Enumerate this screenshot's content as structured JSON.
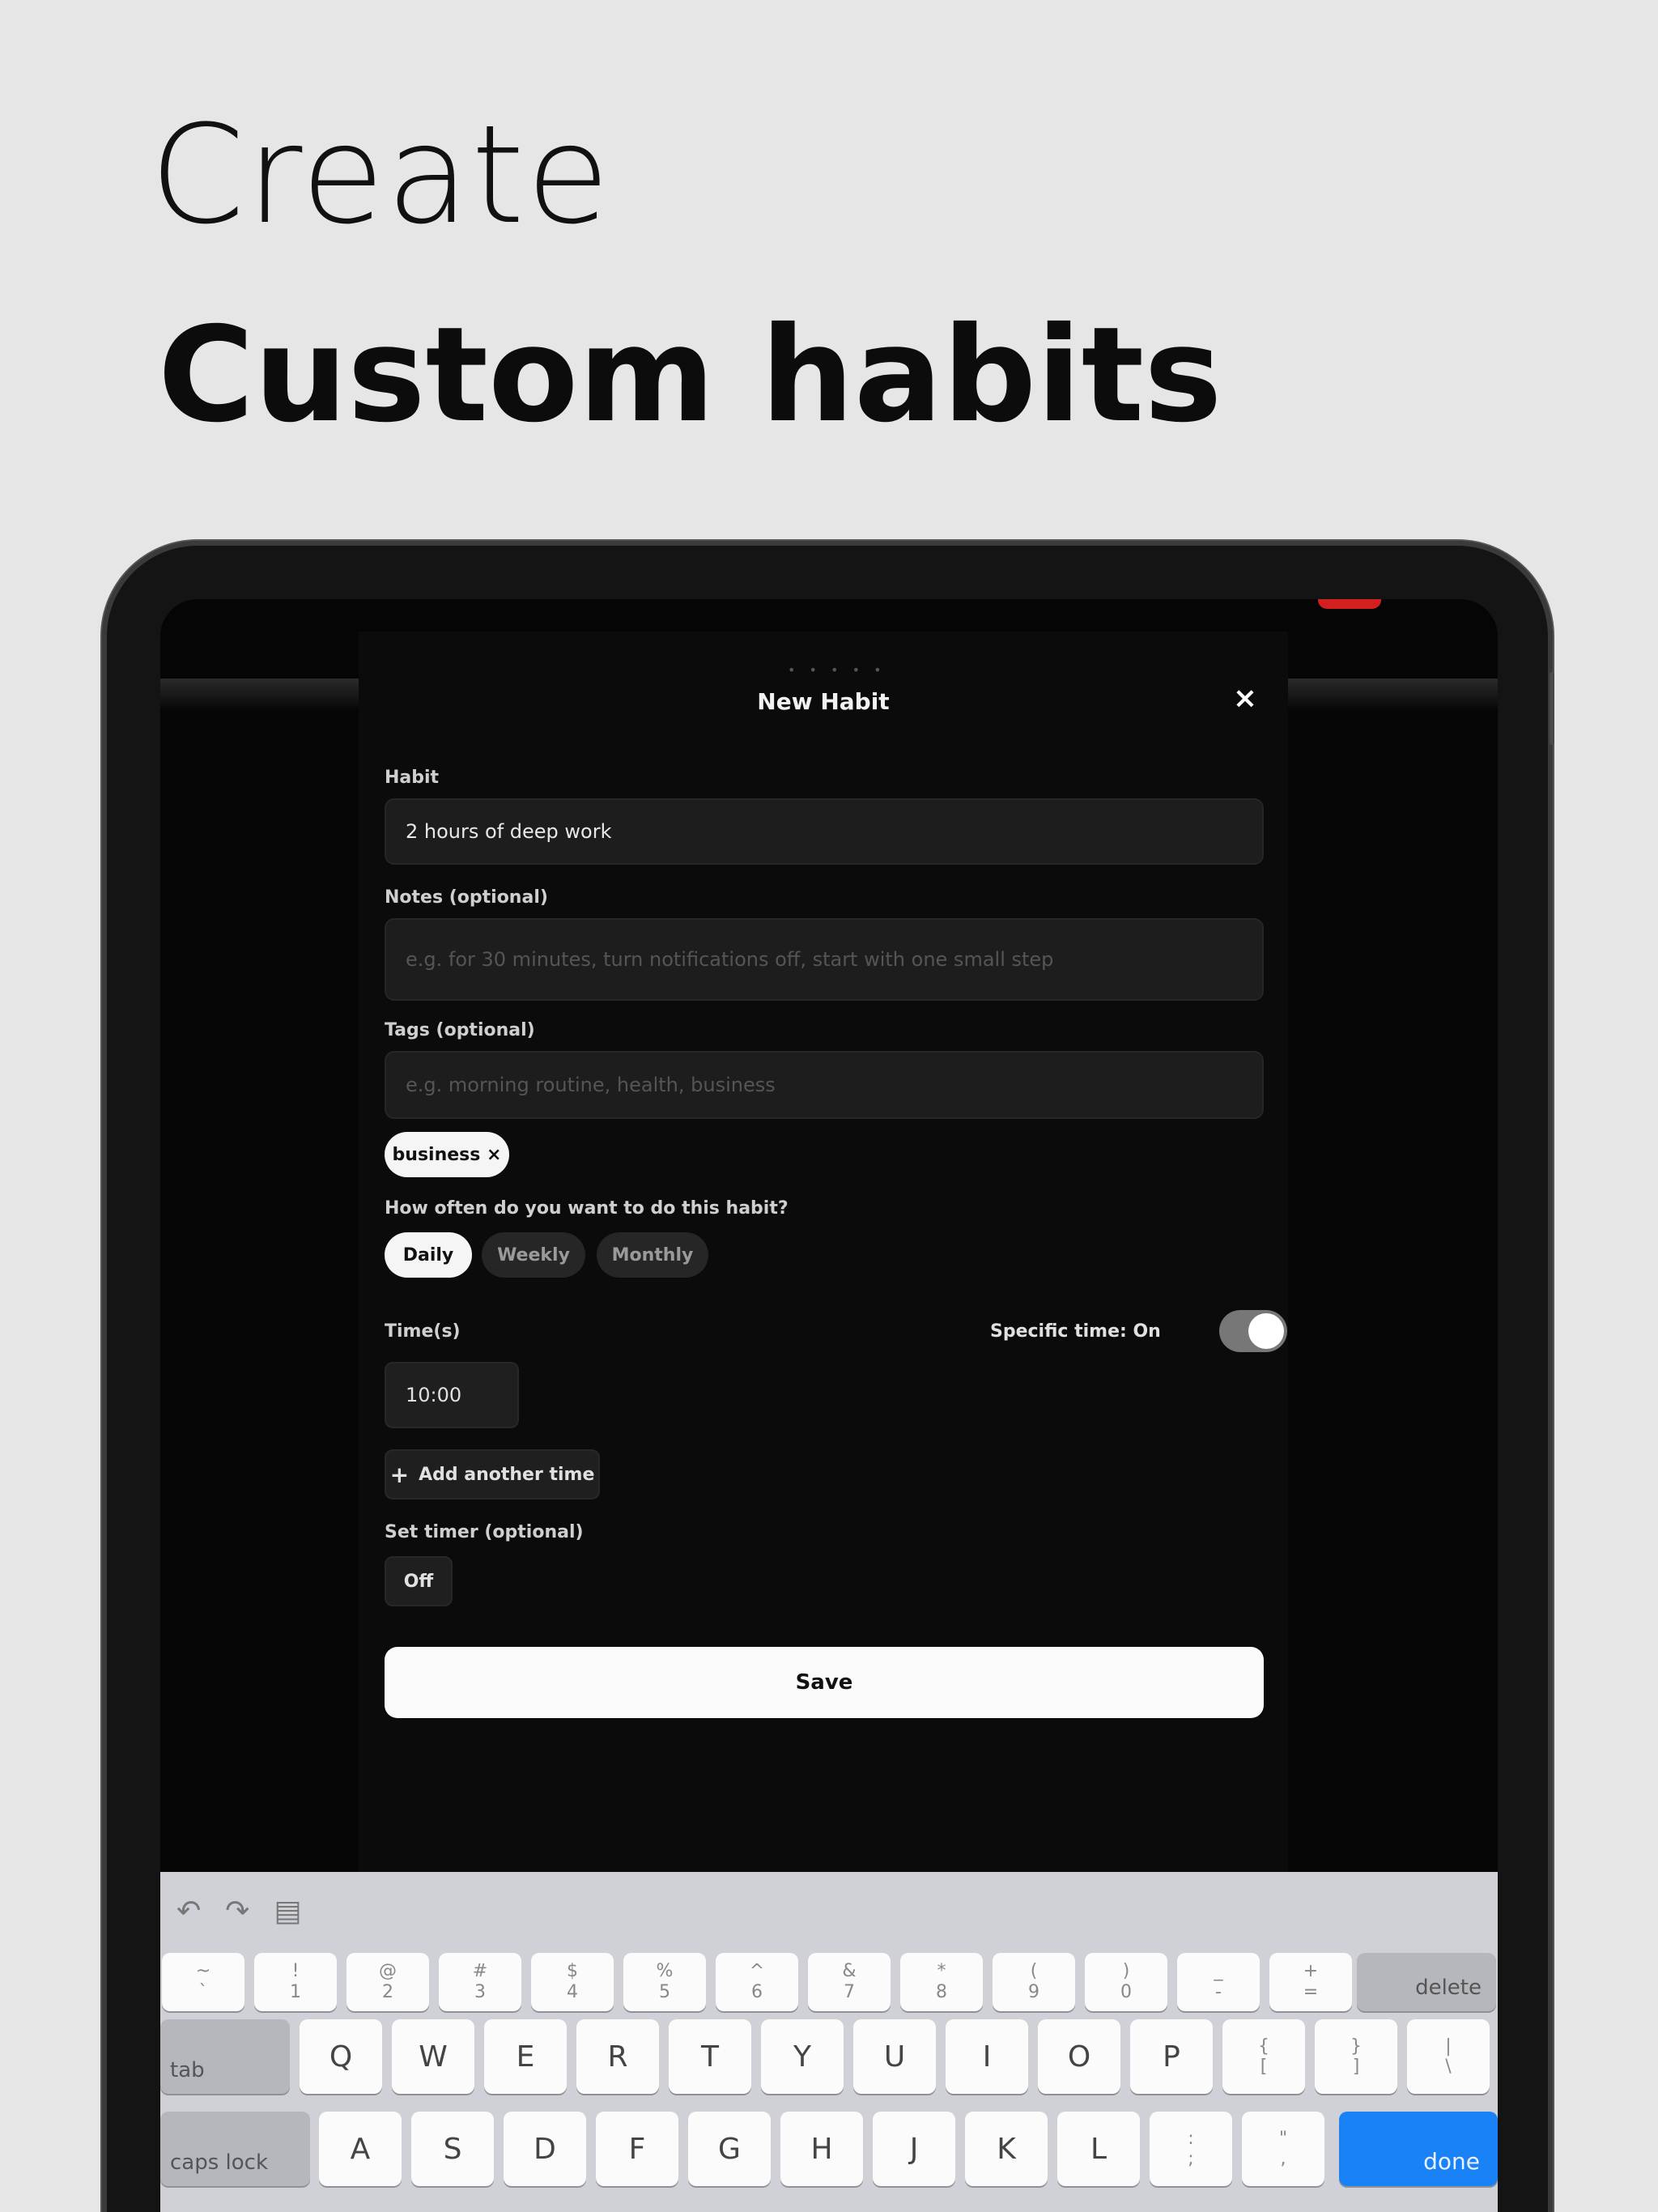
{
  "headline": {
    "line1": "Create",
    "line2": "Custom habits"
  },
  "sheet": {
    "title": "New Habit",
    "close": "×",
    "habit": {
      "label": "Habit",
      "value": "2 hours of deep work"
    },
    "notes": {
      "label": "Notes (optional)",
      "placeholder": "e.g. for 30 minutes, turn notifications off, start with one small step"
    },
    "tags": {
      "label": "Tags (optional)",
      "placeholder": "e.g. morning routine, health, business",
      "chips": [
        "business ×"
      ]
    },
    "frequency": {
      "label": "How often do you want to do this habit?",
      "options": [
        "Daily",
        "Weekly",
        "Monthly"
      ],
      "selected": "Daily"
    },
    "times": {
      "label": "Time(s)",
      "specific_label": "Specific time: On",
      "specific_on": true,
      "values": [
        "10:00"
      ],
      "add_label": "Add another time"
    },
    "timer": {
      "label": "Set timer (optional)",
      "value": "Off"
    },
    "save_label": "Save"
  },
  "keyboard": {
    "toolbar_icons": [
      "undo-icon",
      "redo-icon",
      "clipboard-icon"
    ],
    "number_row": [
      {
        "top": "~",
        "bot": "`"
      },
      {
        "top": "!",
        "bot": "1"
      },
      {
        "top": "@",
        "bot": "2"
      },
      {
        "top": "#",
        "bot": "3"
      },
      {
        "top": "$",
        "bot": "4"
      },
      {
        "top": "%",
        "bot": "5"
      },
      {
        "top": "^",
        "bot": "6"
      },
      {
        "top": "&",
        "bot": "7"
      },
      {
        "top": "*",
        "bot": "8"
      },
      {
        "top": "(",
        "bot": "9"
      },
      {
        "top": ")",
        "bot": "0"
      },
      {
        "top": "_",
        "bot": "-"
      },
      {
        "top": "+",
        "bot": "="
      }
    ],
    "delete": "delete",
    "tab": "tab",
    "row_q": [
      "Q",
      "W",
      "E",
      "R",
      "T",
      "Y",
      "U",
      "I",
      "O",
      "P"
    ],
    "row_q_symbols": [
      {
        "top": "{",
        "bot": "["
      },
      {
        "top": "}",
        "bot": "]"
      },
      {
        "top": "|",
        "bot": "\\"
      }
    ],
    "caps": "caps lock",
    "row_a": [
      "A",
      "S",
      "D",
      "F",
      "G",
      "H",
      "J",
      "K",
      "L"
    ],
    "row_a_symbols": [
      {
        "top": ":",
        "bot": ";"
      },
      {
        "top": "\"",
        "bot": ","
      }
    ],
    "done": "done"
  }
}
